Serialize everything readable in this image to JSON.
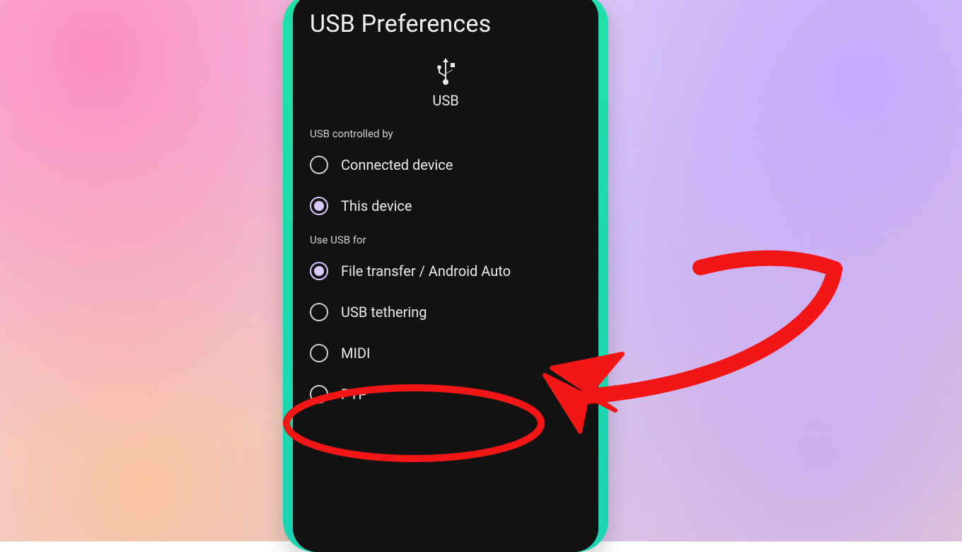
{
  "page": {
    "title": "USB Preferences",
    "header_icon_label": "USB"
  },
  "sections": {
    "controlled_by": {
      "label": "USB controlled by",
      "options": [
        {
          "label": "Connected device",
          "selected": false
        },
        {
          "label": "This device",
          "selected": true
        }
      ]
    },
    "use_for": {
      "label": "Use USB for",
      "options": [
        {
          "label": "File transfer / Android Auto",
          "selected": true
        },
        {
          "label": "USB tethering",
          "selected": false,
          "highlighted": true
        },
        {
          "label": "MIDI",
          "selected": false
        },
        {
          "label": "PTP",
          "selected": false
        }
      ]
    }
  },
  "annotation": {
    "highlight_color": "#f21616"
  }
}
